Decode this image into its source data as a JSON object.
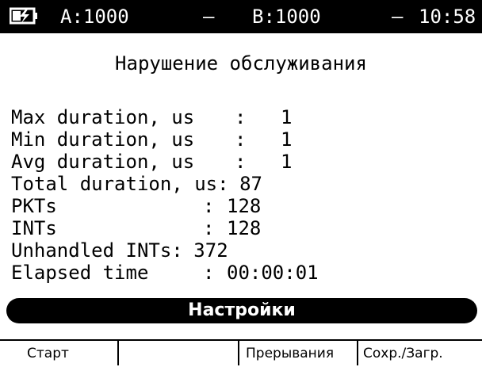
{
  "status": {
    "battery_icon": "battery-charging-icon",
    "a_label": "A:1000",
    "dash1": "–",
    "b_label": "B:1000",
    "dash2": "–",
    "time": "10:58"
  },
  "title": "Нарушение обслуживания",
  "stats": [
    {
      "label": "Max duration, us",
      "value": "1"
    },
    {
      "label": "Min duration, us",
      "value": "1"
    },
    {
      "label": "Avg duration, us",
      "value": "1"
    },
    {
      "label": "Total duration, us",
      "value": "87"
    },
    {
      "label": "PKTs",
      "value": "128"
    },
    {
      "label": "INTs",
      "value": "128"
    },
    {
      "label": "Unhandled INTs",
      "value": "372"
    },
    {
      "label": "Elapsed time",
      "value": "00:00:01"
    }
  ],
  "settings_button": "Настройки",
  "function_keys": [
    "Старт",
    "",
    "Прерывания",
    "Сохр./Загр."
  ]
}
